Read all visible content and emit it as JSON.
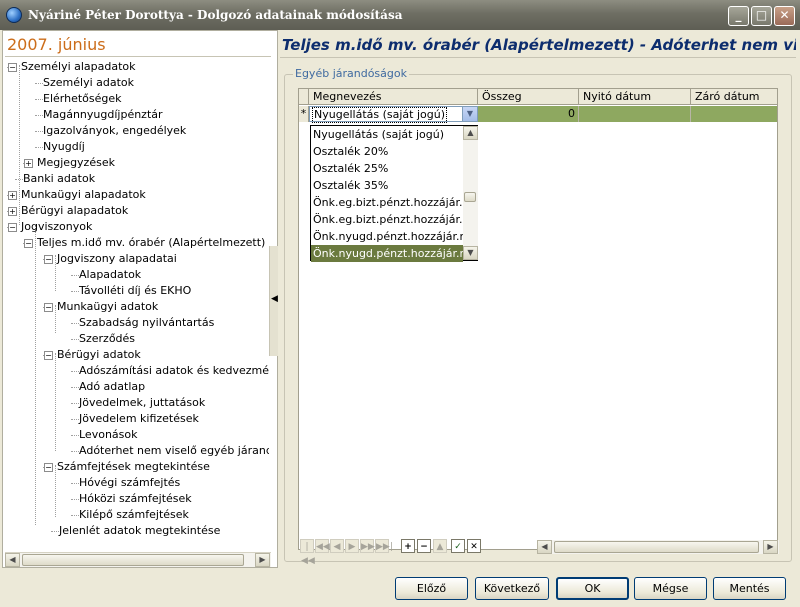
{
  "window": {
    "title": "Nyáriné Péter Dorottya - Dolgozó adatainak módosítása",
    "min_glyph": "_",
    "max_glyph": "□",
    "close_glyph": "✕"
  },
  "left": {
    "date_header": "2007. június",
    "splitter_glyph": "◀",
    "tree": [
      {
        "label": "Személyi alapadatok",
        "toggle": "−"
      },
      {
        "label": "Személyi adatok"
      },
      {
        "label": "Elérhetőségek"
      },
      {
        "label": "Magánnyugdíjpénztár"
      },
      {
        "label": "Igazolványok, engedélyek"
      },
      {
        "label": "Nyugdíj"
      },
      {
        "label": "Megjegyzések",
        "toggle": "+"
      },
      {
        "label": "Banki adatok"
      },
      {
        "label": "Munkaügyi alapadatok",
        "toggle": "+"
      },
      {
        "label": "Bérügyi alapadatok",
        "toggle": "+"
      },
      {
        "label": "Jogviszonyok",
        "toggle": "−"
      },
      {
        "label": "Teljes m.idő  mv. órabér (Alapértelmezett)",
        "toggle": "−"
      },
      {
        "label": "Jogviszony alapadatai",
        "toggle": "−"
      },
      {
        "label": "Alapadatok"
      },
      {
        "label": "Távolléti díj és EKHO"
      },
      {
        "label": "Munkaügyi adatok",
        "toggle": "−"
      },
      {
        "label": "Szabadság nyilvántartás"
      },
      {
        "label": "Szerződés"
      },
      {
        "label": "Bérügyi adatok",
        "toggle": "−"
      },
      {
        "label": "Adószámítási adatok és kedvezménye"
      },
      {
        "label": "Adó adatlap"
      },
      {
        "label": "Jövedelmek, juttatások"
      },
      {
        "label": "Jövedelem kifizetések"
      },
      {
        "label": "Levonások"
      },
      {
        "label": "Adóterhet nem viselő egyéb járandós"
      },
      {
        "label": "Számfejtések megtekintése",
        "toggle": "−"
      },
      {
        "label": "Hóvégi számfejtés"
      },
      {
        "label": "Hóközi számfejtések"
      },
      {
        "label": "Kilépő számfejtések"
      },
      {
        "label": "Jelenlét adatok megtekintése"
      }
    ]
  },
  "right": {
    "header": "Teljes m.idő  mv. órabér (Alapértelmezett) - Adóterhet nem viselő egyéb járandóságok",
    "group_title": "Egyéb járandóságok",
    "columns": [
      "Megnevezés",
      "Összeg",
      "Nyitó dátum",
      "Záró dátum"
    ],
    "row": {
      "marker": "*",
      "name": "Nyugellátás (saját jogú)",
      "amount": "0",
      "open_date": "",
      "close_date": ""
    },
    "dropdown_options": [
      "Nyugellátás (saját jogú)",
      "Osztalék 20%",
      "Osztalék 25%",
      "Osztalék 35%",
      "Önk.eg.bizt.pénzt.hozzájár.ne",
      "Önk.eg.bizt.pénzt.hozzájár.re",
      "Önk.nyugd.pénzt.hozzájár.ne",
      "Önk.nyugd.pénzt.hozzájár.re"
    ],
    "dropdown_selected_index": 7,
    "nav": {
      "first": "|◀◀",
      "prev_page": "◀◀",
      "prev": "◀",
      "next": "▶",
      "next_page": "▶▶",
      "last": "▶▶|",
      "add": "+",
      "delete": "−",
      "up": "▲",
      "confirm": "✓",
      "cancel": "✕"
    }
  },
  "footer": {
    "prev_label": "Előző",
    "next_label": "Következő",
    "ok_label": "OK",
    "cancel_label": "Mégse",
    "save_label": "Mentés"
  }
}
